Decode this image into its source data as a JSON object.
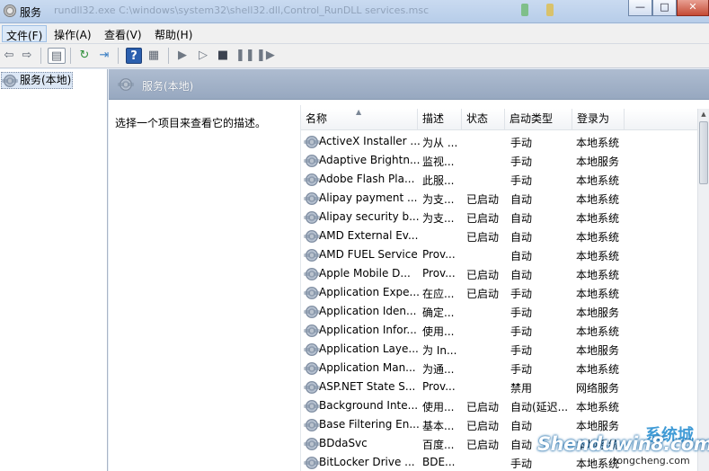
{
  "window": {
    "title": "服务",
    "title_path": "rundll32.exe C:\\windows\\system32\\shell32.dll,Control_RunDLL services.msc",
    "controls": {
      "minimize": "—",
      "maximize": "□",
      "close": "✕"
    }
  },
  "menu": [
    {
      "label": "文件(F)"
    },
    {
      "label": "操作(A)"
    },
    {
      "label": "查看(V)"
    },
    {
      "label": "帮助(H)"
    }
  ],
  "toolbar": {
    "icons": [
      "back-icon",
      "forward-icon",
      "show-tree-icon",
      "refresh-icon",
      "export-list-icon",
      "help-icon",
      "properties-icon",
      "start-icon",
      "start-alt-icon",
      "stop-icon",
      "pause-icon",
      "restart-icon"
    ]
  },
  "tree": {
    "item_label": "服务(本地)"
  },
  "panel": {
    "title": "服务(本地)",
    "description": "选择一个项目来查看它的描述。"
  },
  "list": {
    "columns": [
      "名称",
      "描述",
      "状态",
      "启动类型",
      "登录为"
    ],
    "rows": [
      {
        "name": "ActiveX Installer ...",
        "desc": "为从 ...",
        "status": "",
        "startup": "手动",
        "logon": "本地系统"
      },
      {
        "name": "Adaptive Brightn...",
        "desc": "监视...",
        "status": "",
        "startup": "手动",
        "logon": "本地服务"
      },
      {
        "name": "Adobe Flash Pla...",
        "desc": "此服...",
        "status": "",
        "startup": "手动",
        "logon": "本地系统"
      },
      {
        "name": "Alipay payment ...",
        "desc": "为支...",
        "status": "已启动",
        "startup": "自动",
        "logon": "本地系统"
      },
      {
        "name": "Alipay security b...",
        "desc": "为支...",
        "status": "已启动",
        "startup": "自动",
        "logon": "本地系统"
      },
      {
        "name": "AMD External Ev...",
        "desc": "",
        "status": "已启动",
        "startup": "自动",
        "logon": "本地系统"
      },
      {
        "name": "AMD FUEL Service",
        "desc": "Prov...",
        "status": "",
        "startup": "自动",
        "logon": "本地系统"
      },
      {
        "name": "Apple Mobile D...",
        "desc": "Prov...",
        "status": "已启动",
        "startup": "自动",
        "logon": "本地系统"
      },
      {
        "name": "Application Expe...",
        "desc": "在应...",
        "status": "已启动",
        "startup": "手动",
        "logon": "本地系统"
      },
      {
        "name": "Application Iden...",
        "desc": "确定...",
        "status": "",
        "startup": "手动",
        "logon": "本地服务"
      },
      {
        "name": "Application Infor...",
        "desc": "使用...",
        "status": "",
        "startup": "手动",
        "logon": "本地系统"
      },
      {
        "name": "Application Laye...",
        "desc": "为 In...",
        "status": "",
        "startup": "手动",
        "logon": "本地服务"
      },
      {
        "name": "Application Man...",
        "desc": "为通...",
        "status": "",
        "startup": "手动",
        "logon": "本地系统"
      },
      {
        "name": "ASP.NET State S...",
        "desc": "Prov...",
        "status": "",
        "startup": "禁用",
        "logon": "网络服务"
      },
      {
        "name": "Background Inte...",
        "desc": "使用...",
        "status": "已启动",
        "startup": "自动(延迟...",
        "logon": "本地系统"
      },
      {
        "name": "Base Filtering En...",
        "desc": "基本...",
        "status": "已启动",
        "startup": "自动",
        "logon": "本地服务"
      },
      {
        "name": "BDdaSvc",
        "desc": "百度...",
        "status": "已启动",
        "startup": "自动",
        "logon": "本地系统"
      },
      {
        "name": "BitLocker Drive ...",
        "desc": "BDE...",
        "status": "",
        "startup": "手动",
        "logon": "本地系统"
      }
    ]
  },
  "watermark": {
    "text": "Shenduwin8.com",
    "sub": "tongcheng.com",
    "logo": "系统城"
  },
  "colors": {
    "header_blue": "#97a8c0",
    "selection": "#dce7f5",
    "menubar": "#f0f0f0"
  }
}
